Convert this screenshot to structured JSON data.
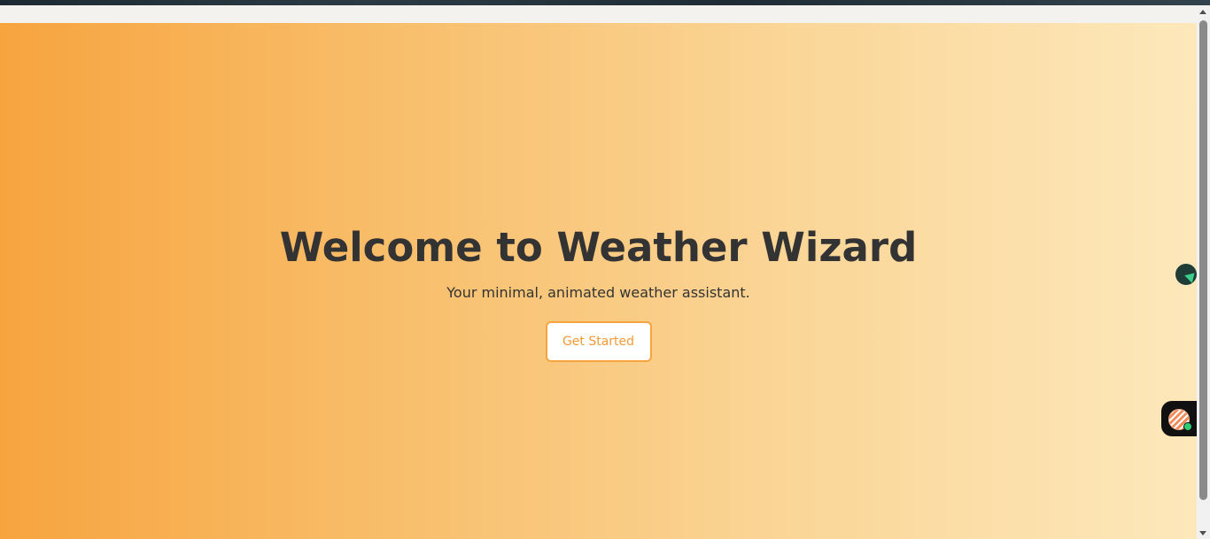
{
  "hero": {
    "title": "Welcome to Weather Wizard",
    "subtitle": "Your minimal, animated weather assistant.",
    "cta_label": "Get Started"
  },
  "colors": {
    "gradient_start": "#f7a43f",
    "gradient_end": "#fde8bb",
    "text": "#333333",
    "accent": "#f39a35"
  },
  "floating_widgets": {
    "top_icon": "grammarly-style-assistant-icon",
    "bottom_icon": "chat-assistant-icon"
  }
}
